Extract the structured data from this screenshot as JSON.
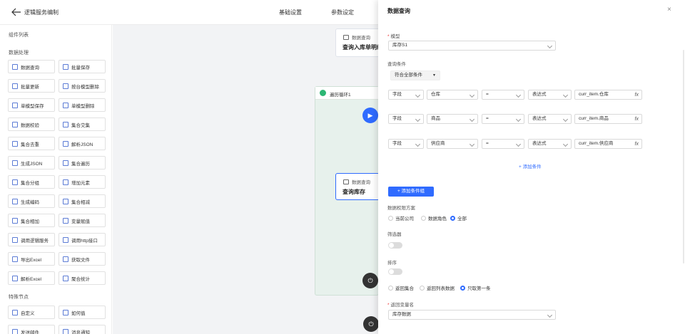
{
  "header": {
    "title": "逻辑服务编制",
    "tabs": [
      "基础设置",
      "参数设定"
    ]
  },
  "sidebar": {
    "title": "组件列表",
    "section1": "数据处理",
    "items": [
      "数据查询",
      "批量保存",
      "批量更新",
      "按台模型删除",
      "单模型保存",
      "单模型删除",
      "数据校验",
      "集合交集",
      "集合去重",
      "解析JSON",
      "生成JSON",
      "集合遍历",
      "集合分组",
      "增加元素",
      "生成编码",
      "集合相减",
      "集合相加",
      "变量赋值",
      "调用逻辑服务",
      "调用http接口",
      "导出Excel",
      "获取文件",
      "解析Excel",
      "聚合统计"
    ],
    "section2": "特殊节点",
    "items2": [
      "自定义",
      "如何值",
      "发送邮件",
      "消息通知"
    ]
  },
  "canvas": {
    "node1": {
      "type": "数据查询",
      "title": "查询入库单明细"
    },
    "loop": {
      "title": "遍历循环1"
    },
    "node2": {
      "type": "数据查询",
      "title": "查询库存"
    }
  },
  "drawer": {
    "title": "数据查询",
    "close": "×",
    "model_label": "模型",
    "model_value": "库存S1",
    "cond_label": "查询条件",
    "cond_mode": "符合全部条件",
    "conditions": [
      {
        "a": "字段",
        "b": "仓库",
        "op": "=",
        "c": "表达式",
        "v": "curr_item.仓库",
        "fx": "fx"
      },
      {
        "a": "字段",
        "b": "商品",
        "op": "=",
        "c": "表达式",
        "v": "curr_item.商品",
        "fx": "fx"
      },
      {
        "a": "字段",
        "b": "供应商",
        "op": "=",
        "c": "表达式",
        "v": "curr_item.供应商",
        "fx": "fx"
      }
    ],
    "add_condition": "+ 添加条件",
    "add_group": "+ 添加条件组",
    "perm_label": "数据权限方案",
    "perm_options": [
      "当前公司",
      "数据角色",
      "全部"
    ],
    "filter_label": "筛选器",
    "sort_label": "排序",
    "return_options": [
      "返回集合",
      "返回列表数据",
      "只取第一条"
    ],
    "return_var_label": "返回变量名",
    "return_var_value": "库存数据"
  }
}
